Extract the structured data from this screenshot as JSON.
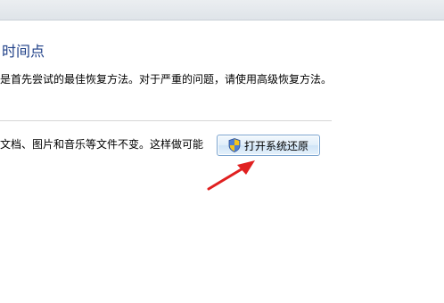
{
  "page": {
    "heading": "时间点",
    "description": "是首先尝试的最佳恢复方法。对于严重的问题，请使用高级恢复方法。",
    "restore_description": "文档、图片和音乐等文件不变。这样做可能",
    "restore_button_label": "打开系统还原"
  },
  "colors": {
    "heading": "#1e3f87",
    "annotation_arrow": "#e02020",
    "button_border": "#7aa4cf"
  },
  "icons": {
    "restore_button": "uac-shield-icon",
    "annotation": "red-arrow-icon"
  }
}
